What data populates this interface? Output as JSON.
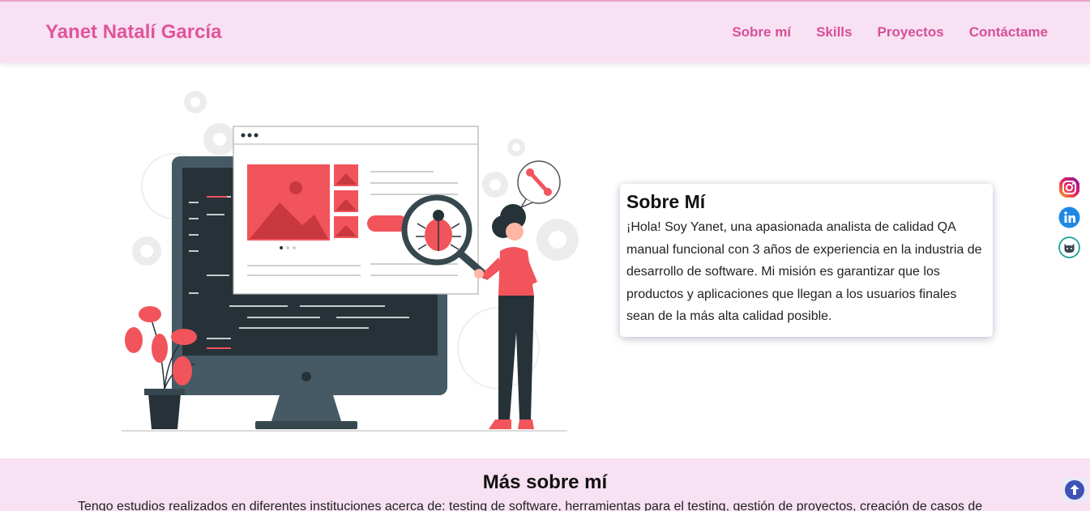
{
  "header": {
    "brand": "Yanet Natalí García",
    "nav": [
      "Sobre mí",
      "Skills",
      "Proyectos",
      "Contáctame"
    ]
  },
  "about": {
    "title": "Sobre Mí",
    "text": "¡Hola! Soy Yanet, una apasionada analista de calidad QA manual funcional con 3 años de experiencia en la industria de desarrollo de software. Mi misión es garantizar que los productos y aplicaciones que llegan a los usuarios finales sean de la más alta calidad posible."
  },
  "social": [
    {
      "icon": "instagram-icon"
    },
    {
      "icon": "linkedin-icon"
    },
    {
      "icon": "github-icon"
    }
  ],
  "more": {
    "title": "Más sobre mí",
    "text": "Tengo estudios realizados en diferentes instituciones acerca de: testing de software, herramientas para el testing, gestión de proyectos, creación de casos de"
  },
  "colors": {
    "brand_pink": "#e0549a",
    "nav_bg": "#f8e1f2",
    "illustration_red": "#f2545b",
    "illustration_dark": "#263238"
  }
}
